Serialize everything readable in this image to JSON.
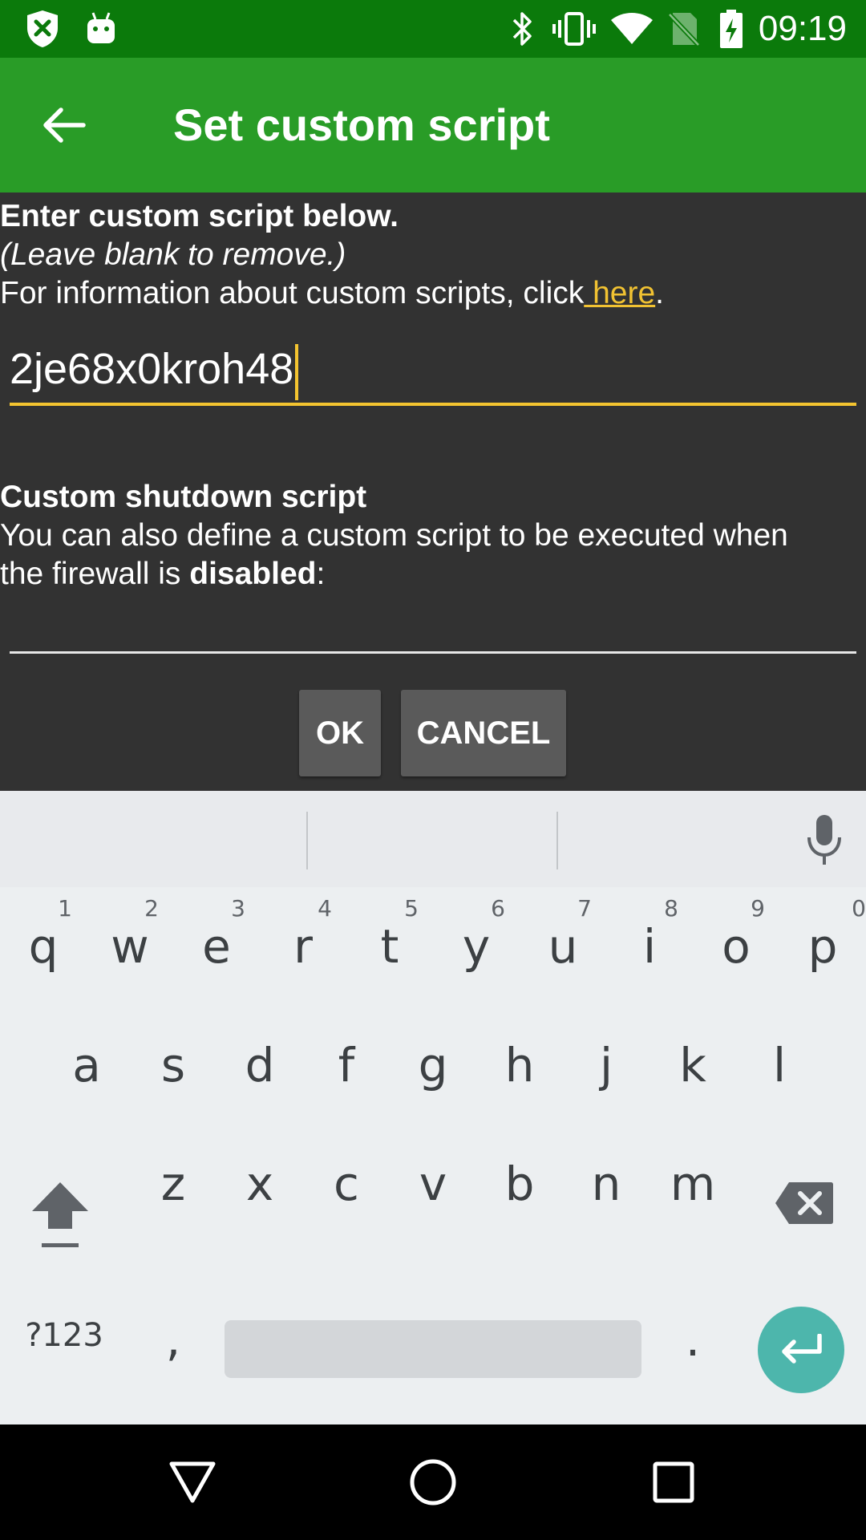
{
  "status_bar": {
    "time": "09:19",
    "left_icons": [
      "shield-x-icon",
      "android-icon"
    ],
    "right_icons": [
      "bluetooth-icon",
      "vibrate-icon",
      "wifi-icon",
      "no-sim-icon",
      "battery-charging-icon"
    ]
  },
  "app_bar": {
    "title": "Set custom script",
    "back_icon": "arrow-back-icon"
  },
  "dialog": {
    "heading": "Enter custom script below.",
    "note": "(Leave blank to remove.)",
    "info_prefix": "For information about custom scripts, click",
    "info_link": " here",
    "info_suffix": ".",
    "script_value": "2je68x0kroh48",
    "shutdown_heading": "Custom shutdown script",
    "shutdown_line1": "You can also define a custom script to be executed when",
    "shutdown_line2_prefix": "the firewall is ",
    "shutdown_line2_bold": "disabled",
    "shutdown_line2_suffix": ":",
    "shutdown_value": "",
    "ok_label": "OK",
    "cancel_label": "CANCEL"
  },
  "keyboard": {
    "row1": [
      {
        "ch": "q",
        "num": "1"
      },
      {
        "ch": "w",
        "num": "2"
      },
      {
        "ch": "e",
        "num": "3"
      },
      {
        "ch": "r",
        "num": "4"
      },
      {
        "ch": "t",
        "num": "5"
      },
      {
        "ch": "y",
        "num": "6"
      },
      {
        "ch": "u",
        "num": "7"
      },
      {
        "ch": "i",
        "num": "8"
      },
      {
        "ch": "o",
        "num": "9"
      },
      {
        "ch": "p",
        "num": "0"
      }
    ],
    "row2": [
      "a",
      "s",
      "d",
      "f",
      "g",
      "h",
      "j",
      "k",
      "l"
    ],
    "row3": [
      "z",
      "x",
      "c",
      "v",
      "b",
      "n",
      "m"
    ],
    "symbols_label": "?123",
    "comma_label": ",",
    "period_label": "."
  },
  "colors": {
    "status_bar": "#0b7a0b",
    "app_bar": "#299c27",
    "accent": "#f4c430",
    "enter_key": "#4db6ac"
  }
}
